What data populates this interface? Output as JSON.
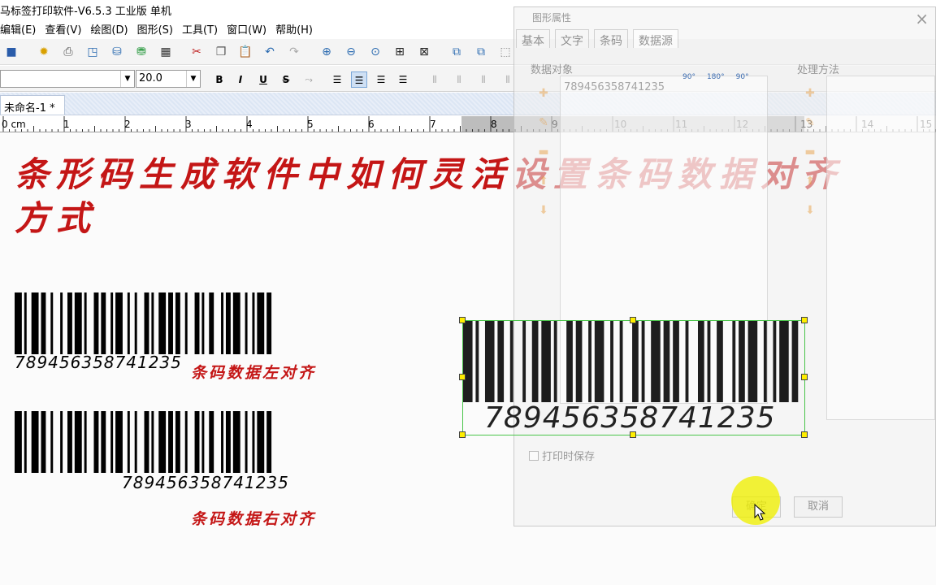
{
  "window": {
    "title": "马标签打印软件-V6.5.3 工业版 单机"
  },
  "menu": [
    "编辑(E)",
    "查看(V)",
    "绘图(D)",
    "图形(S)",
    "工具(T)",
    "窗口(W)",
    "帮助(H)"
  ],
  "format": {
    "font_size": "20.0",
    "bold": "B",
    "italic": "I",
    "underline": "U",
    "strike": "S"
  },
  "document_tab": "未命名-1 *",
  "ruler": {
    "unit": "0 cm",
    "numbers": [
      "1",
      "2",
      "3",
      "4",
      "5",
      "6",
      "7",
      "8",
      "9",
      "10",
      "11",
      "12",
      "13",
      "14",
      "15"
    ]
  },
  "canvas": {
    "headline": "条形码生成软件中如何灵活设置条码数据对齐方式",
    "barcode_left": {
      "number": "789456358741235",
      "label": "条码数据左对齐"
    },
    "barcode_right": {
      "number": "789456358741235",
      "label": "条码数据右对齐"
    },
    "barcode_selected": {
      "number": "789456358741235"
    }
  },
  "dialog": {
    "title": "图形属性",
    "tabs": [
      "基本",
      "文字",
      "条码",
      "数据源"
    ],
    "active_tab": "数据源",
    "data_objects_label": "数据对象",
    "processing_label": "处理方法",
    "data_object_item": "789456358741235",
    "print_save_label": "打印时保存",
    "ok_button": "确定",
    "cancel_button": "取消",
    "rotate_labels": [
      "90°",
      "180°",
      "90°"
    ]
  },
  "colors": {
    "accent_red": "#c41616",
    "highlight": "#f0f000"
  }
}
